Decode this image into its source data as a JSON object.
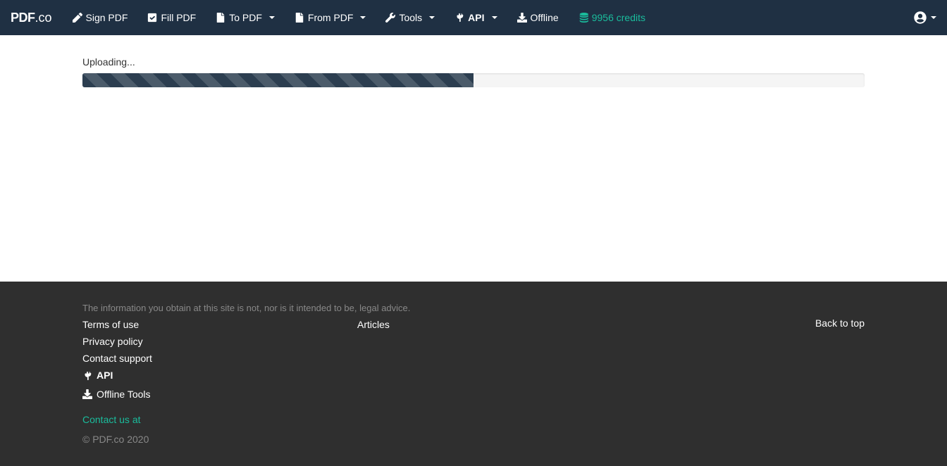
{
  "brand": {
    "p1": "PDF",
    "p2": ".co"
  },
  "nav": {
    "sign": "Sign PDF",
    "fill": "Fill PDF",
    "to": "To PDF",
    "from": "From PDF",
    "tools": "Tools",
    "api": "API",
    "offline": "Offline",
    "credits": "9956 credits"
  },
  "main": {
    "status": "Uploading...",
    "progress_percent": 50
  },
  "footer": {
    "disclaimer": "The information you obtain at this site is not, nor is it intended to be, legal advice.",
    "links1": {
      "terms": "Terms of use",
      "privacy": "Privacy policy",
      "support": "Contact support",
      "api": "API",
      "offline": "Offline Tools"
    },
    "links2": {
      "articles": "Articles"
    },
    "backtotop": "Back to top",
    "contact": "Contact us at",
    "copyright": "© PDF.co 2020"
  }
}
